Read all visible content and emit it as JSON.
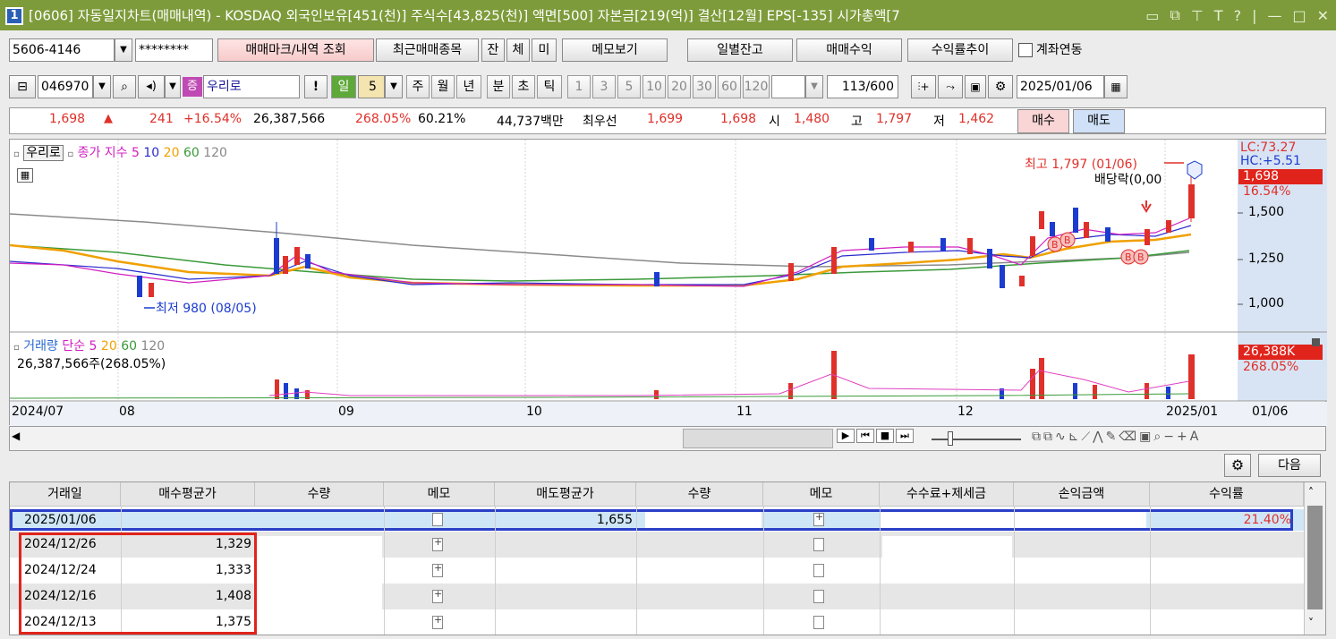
{
  "window": {
    "number": "1",
    "title": "[0606] 자동일지차트(매매내역) - KOSDAQ 외국인보유[451(천)] 주식수[43,825(천)] 액면[500] 자본금[219(억)] 결산[12월] EPS[-135] 시가총액[7",
    "controls": [
      "▭",
      "⧉",
      "⊤",
      "T",
      "?",
      "|",
      "—",
      "□",
      "✕"
    ]
  },
  "toolbar1": {
    "account": "5606-4146",
    "password": "********",
    "inquiry_btn": "매매마크/내역 조회",
    "recent_btn": "최근매매종목",
    "tabs": [
      "잔",
      "체",
      "미"
    ],
    "memo_btn": "메모보기",
    "daily_btn": "일별잔고",
    "profit_btn": "매매수익",
    "rate_btn": "수익률추이",
    "link_label": "계좌연동"
  },
  "toolbar2": {
    "code": "046970",
    "badge": "증",
    "name": "우리로",
    "period_day": "일",
    "period_value": "5",
    "periods": [
      "주",
      "월",
      "년",
      "분",
      "초",
      "틱"
    ],
    "intervals": [
      "1",
      "3",
      "5",
      "10",
      "20",
      "30",
      "60",
      "120"
    ],
    "count": "113",
    "count_total": "/600",
    "date": "2025/01/06"
  },
  "quote": {
    "price": "1,698",
    "change": "241",
    "change_pct": "+16.54%",
    "volume": "26,387,566",
    "vol_ratio": "268.05%",
    "turnover": "60.21%",
    "amount": "44,737백만",
    "best_label": "최우선",
    "best_ask": "1,699",
    "best_bid": "1,698",
    "open_label": "시",
    "open": "1,480",
    "high_label": "고",
    "high": "1,797",
    "low_label": "저",
    "low": "1,462",
    "buy_btn": "매수",
    "sell_btn": "매도"
  },
  "price_panel": {
    "name_label": "우리로",
    "ma_label": "종가 지수",
    "ma_periods": [
      "5",
      "10",
      "20",
      "60",
      "120"
    ],
    "max_label": "최고 1,797 (01/06)",
    "min_label": "최저 980 (08/05)",
    "dividend_label": "배당락(0,00",
    "lc": "LC:73.27",
    "hc": "HC:+5.51",
    "current_tag": "1,698",
    "current_pct": "16.54%",
    "axis": [
      "1,500",
      "1,250",
      "1,000"
    ]
  },
  "volume_panel": {
    "label": "거래량",
    "ma_label": "단순",
    "ma_periods": [
      "5",
      "20",
      "60",
      "120"
    ],
    "value_text": "26,387,566주(268.05%)",
    "tag": "26,388K",
    "tag_pct": "268.05%"
  },
  "date_axis": [
    "2024/07",
    "08",
    "09",
    "10",
    "11",
    "12",
    "2025/01",
    "01/06"
  ],
  "next_btn": "다음",
  "table": {
    "columns": [
      "거래일",
      "매수평균가",
      "수량",
      "메모",
      "매도평균가",
      "수량",
      "메모",
      "수수료+제세금",
      "손익금액",
      "수익률"
    ],
    "rows": [
      {
        "date": "2025/01/06",
        "buy_avg": "",
        "sell_avg": "1,655",
        "rate": "21.40%"
      },
      {
        "date": "2024/12/26",
        "buy_avg": "1,329",
        "sell_avg": "",
        "rate": ""
      },
      {
        "date": "2024/12/24",
        "buy_avg": "1,333",
        "sell_avg": "",
        "rate": ""
      },
      {
        "date": "2024/12/16",
        "buy_avg": "1,408",
        "sell_avg": "",
        "rate": ""
      },
      {
        "date": "2024/12/13",
        "buy_avg": "1,375",
        "sell_avg": "",
        "rate": ""
      }
    ]
  },
  "colors": {
    "title_bar": "#7d9b3a",
    "up": "#e0302a",
    "down": "#1c3ccf",
    "highlight_box_blue": "#2b3fc8",
    "highlight_box_red": "#e0241c",
    "selected_row": "#cfe6f7"
  }
}
